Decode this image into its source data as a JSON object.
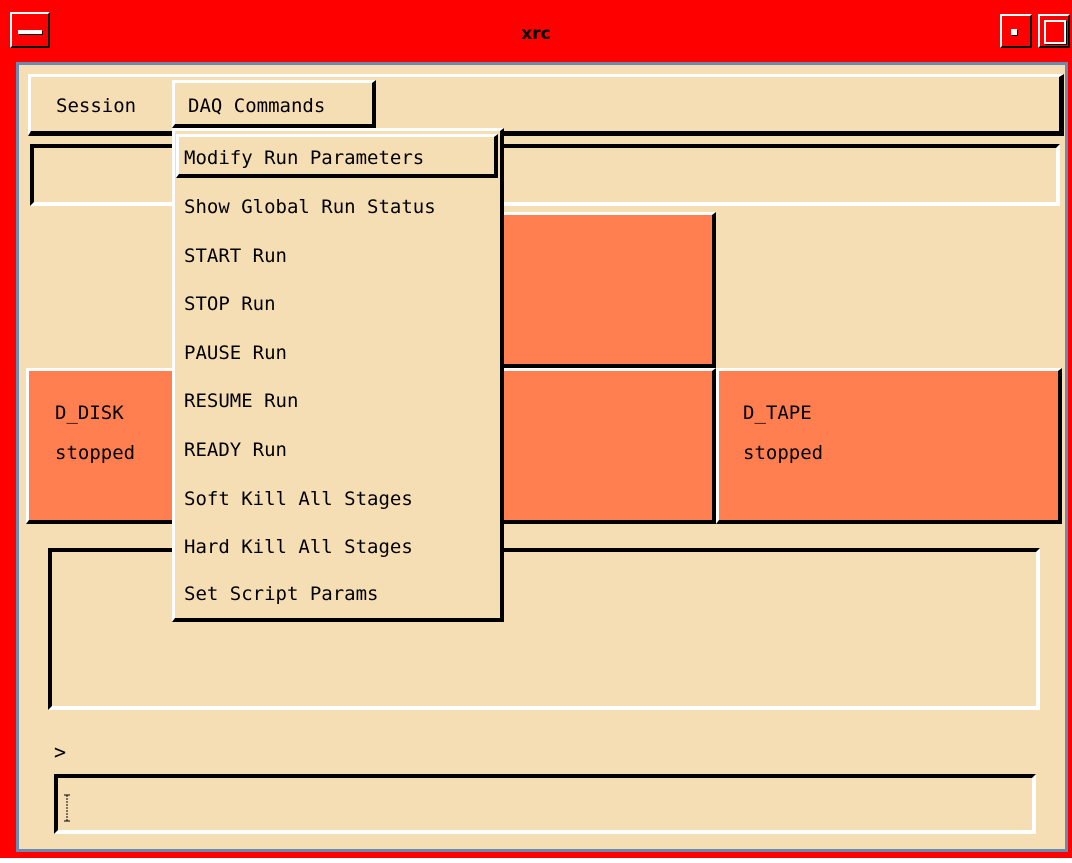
{
  "window": {
    "title": "xrc"
  },
  "menubar": {
    "session_label": "Session",
    "daq_label": "DAQ Commands"
  },
  "dropdown": {
    "items": [
      {
        "label": "Modify Run Parameters",
        "highlighted": true
      },
      {
        "label": "Show Global Run Status"
      },
      {
        "label": "START Run"
      },
      {
        "label": "STOP Run"
      },
      {
        "label": "PAUSE Run"
      },
      {
        "label": "RESUME Run"
      },
      {
        "label": "READY Run"
      },
      {
        "label": "Soft Kill All Stages"
      },
      {
        "label": "Hard Kill All Stages"
      },
      {
        "label": "Set Script Params"
      }
    ]
  },
  "stages": {
    "d_disk": {
      "name": "D_DISK",
      "status": "stopped"
    },
    "d_tape": {
      "name": "D_TAPE",
      "status": "stopped"
    }
  },
  "console": {
    "prompt": ">",
    "input_value": ""
  },
  "colors": {
    "title_bar": "#ff0000",
    "background": "#f5deb3",
    "stage_fill": "#ff7f50"
  }
}
